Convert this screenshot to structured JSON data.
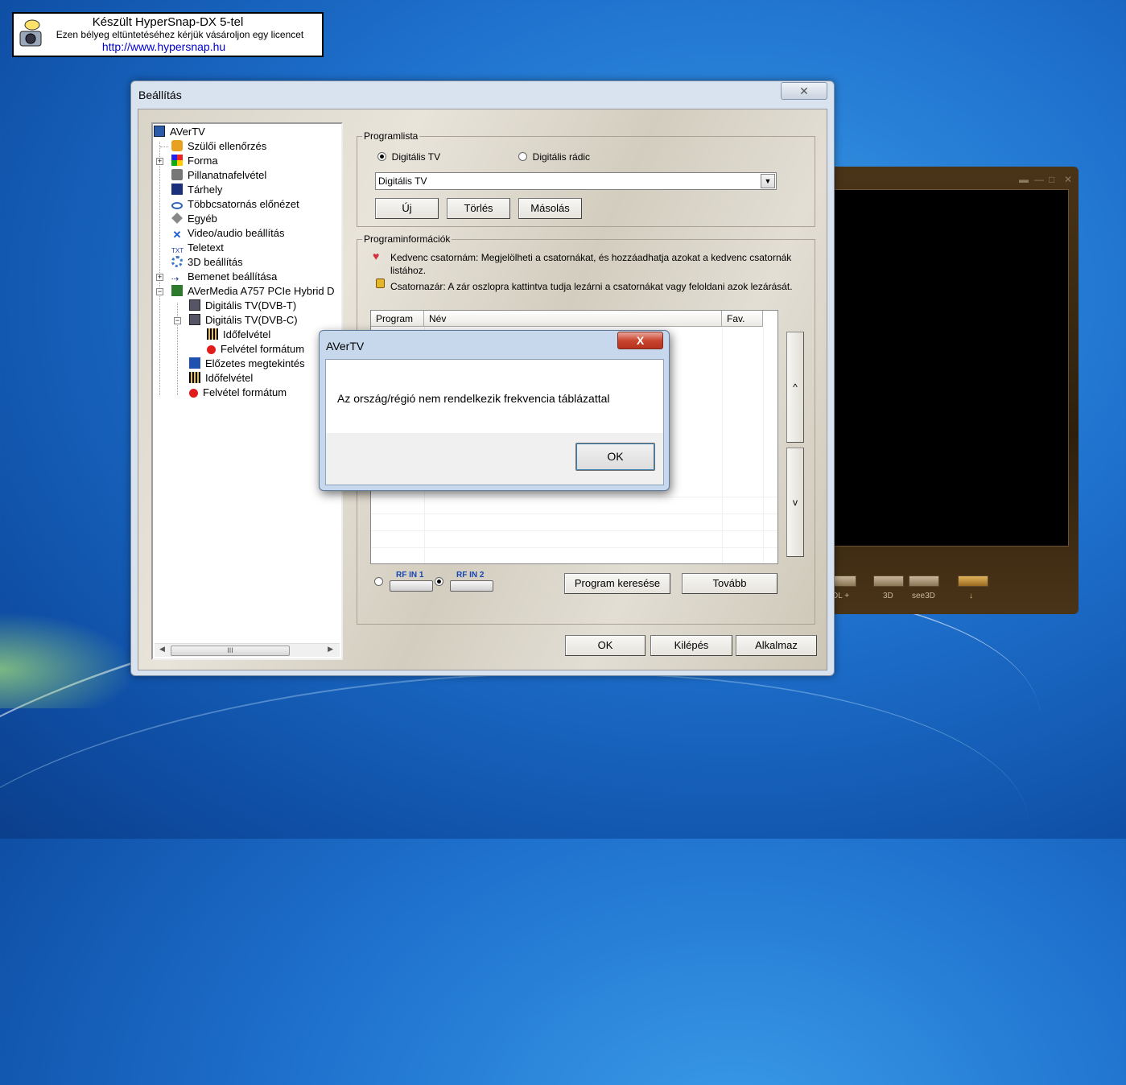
{
  "stamp": {
    "line1": "Készült HyperSnap-DX 5-tel",
    "line2": "Ezen bélyeg eltüntetéséhez kérjük vásároljon egy licencet",
    "url": "http://www.hypersnap.hu"
  },
  "player": {
    "buttons": [
      "DL +",
      "3D",
      "see3D",
      "↓"
    ]
  },
  "settings_window": {
    "title": "Beállítás",
    "tree": [
      {
        "label": "AVerTV",
        "icon": "avertv-icon"
      },
      {
        "label": "Szülői ellenőrzés",
        "icon": "parental-control-icon"
      },
      {
        "label": "Forma",
        "icon": "skin-icon"
      },
      {
        "label": "Pillanatnafelvétel",
        "icon": "snapshot-icon"
      },
      {
        "label": "Tárhely",
        "icon": "storage-icon"
      },
      {
        "label": "Többcsatornás előnézet",
        "icon": "preview-icon"
      },
      {
        "label": "Egyéb",
        "icon": "misc-icon"
      },
      {
        "label": "Video/audio beállítás",
        "icon": "tools-icon"
      },
      {
        "label": "Teletext",
        "icon": "teletext-icon"
      },
      {
        "label": "3D beállítás",
        "icon": "gear-icon"
      },
      {
        "label": "Bemenet beállítása",
        "icon": "input-icon"
      },
      {
        "label": "AVerMedia A757 PCIe Hybrid D",
        "icon": "card-icon"
      },
      {
        "label": "Digitális TV(DVB-T)",
        "icon": "tv-icon"
      },
      {
        "label": "Digitális TV(DVB-C)",
        "icon": "tv-icon"
      },
      {
        "label": "Időfelvétel",
        "icon": "schedule-icon"
      },
      {
        "label": "Felvétel formátum",
        "icon": "record-icon"
      },
      {
        "label": "Előzetes megtekintés",
        "icon": "preview-check-icon"
      },
      {
        "label": "Időfelvétel",
        "icon": "schedule-icon"
      },
      {
        "label": "Felvétel formátum",
        "icon": "record-icon"
      }
    ],
    "programlist": {
      "legend": "Programlista",
      "radio_tv": "Digitális TV",
      "radio_radio": "Digitális rádic",
      "combo_value": "Digitális TV",
      "btn_new": "Új",
      "btn_delete": "Törlés",
      "btn_copy": "Másolás"
    },
    "programinfo": {
      "legend": "Programinformációk",
      "fav_text": "Kedvenc csatornám: Megjelölheti a csatornákat, és hozzáadhatja azokat a kedvenc csatornák listához.",
      "lock_text": "Csatornazár: A zár oszlopra kattintva tudja lezárni a csatornákat vagy feloldani azok lezárását.",
      "columns": [
        "Program",
        "Név",
        "Fav."
      ],
      "up_label": "^",
      "down_label": "v",
      "rf1": "RF IN 1",
      "rf2": "RF IN 2",
      "btn_search": "Program keresése",
      "btn_next": "Tovább"
    },
    "footer": {
      "ok": "OK",
      "exit": "Kilépés",
      "apply": "Alkalmaz"
    }
  },
  "message_box": {
    "title": "AVerTV",
    "close": "X",
    "text": "Az ország/régió nem rendelkezik frekvencia táblázattal",
    "ok": "OK"
  }
}
